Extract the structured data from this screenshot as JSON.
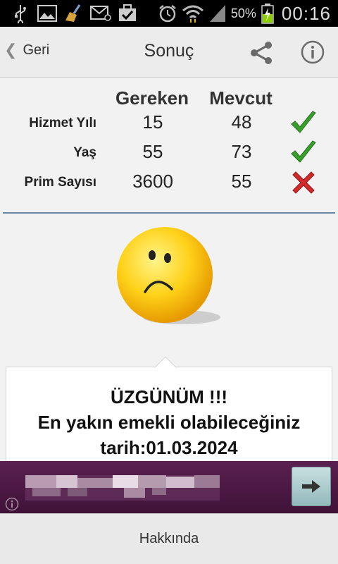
{
  "status_bar": {
    "battery_pct": "50%",
    "time": "00:16",
    "icons": [
      "usb-icon",
      "image-icon",
      "broom-icon",
      "mail-icon",
      "briefcase-check-icon",
      "alarm-icon",
      "wifi-icon",
      "signal-icon",
      "battery-icon"
    ]
  },
  "actionbar": {
    "back_label": "Geri",
    "title": "Sonuç"
  },
  "table": {
    "headers": [
      "Gereken",
      "Mevcut"
    ],
    "rows": [
      {
        "label": "Hizmet Yılı",
        "required": "15",
        "current": "48",
        "status": "ok"
      },
      {
        "label": "Yaş",
        "required": "55",
        "current": "73",
        "status": "ok"
      },
      {
        "label": "Prim Sayısı",
        "required": "3600",
        "current": "55",
        "status": "fail"
      }
    ]
  },
  "result": {
    "line1": "ÜZGÜNÜM !!!",
    "line2": "En yakın emekli olabileceğiniz",
    "line3": "tarih:01.03.2024"
  },
  "footer": {
    "about_label": "Hakkında"
  },
  "colors": {
    "ok": "#3aa02c",
    "fail": "#d22a2a",
    "divider": "#6e89a2",
    "ad_bg": "#4b1a44"
  }
}
